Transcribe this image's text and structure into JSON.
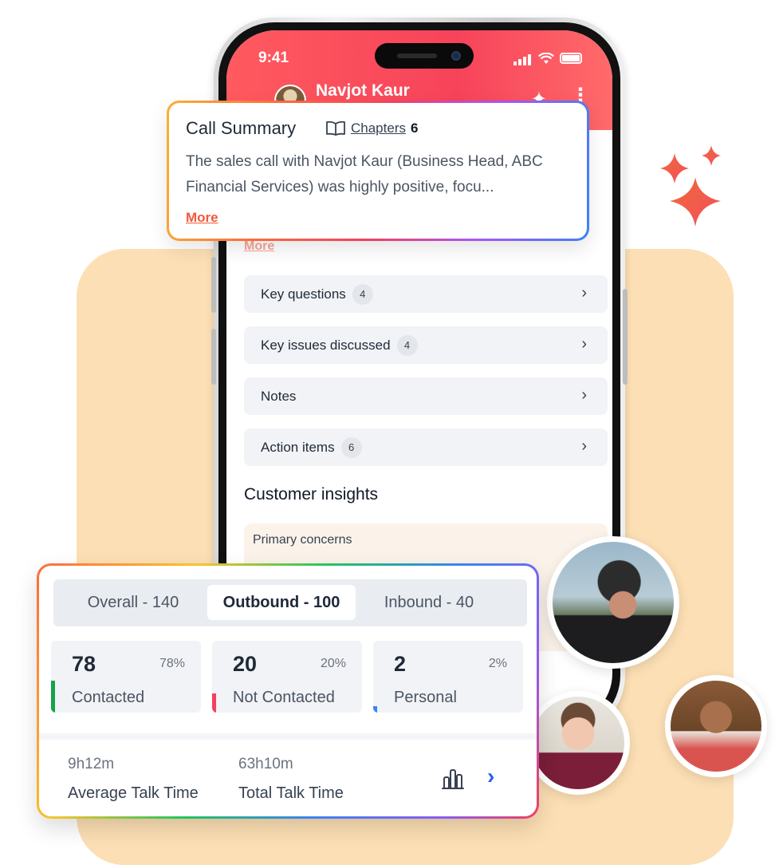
{
  "phone": {
    "status": {
      "time": "9:41"
    },
    "header": {
      "contact_name": "Navjot Kaur"
    },
    "faded_more": "More",
    "list_items": [
      {
        "label": "Key questions",
        "count": "4"
      },
      {
        "label": "Key issues discussed",
        "count": "4"
      },
      {
        "label": "Notes",
        "count": ""
      },
      {
        "label": "Action items",
        "count": "6"
      }
    ],
    "insights_title": "Customer insights",
    "concerns_label": "Primary concerns"
  },
  "summary_card": {
    "title": "Call Summary",
    "chapters_label": "Chapters",
    "chapters_count": "6",
    "text": "The sales call with Navjot Kaur (Business Head, ABC Financial Services) was highly positive, focu...",
    "more_label": "More"
  },
  "stats_card": {
    "tabs": [
      {
        "label": "Overall - 140",
        "active": false
      },
      {
        "label": "Outbound - 100",
        "active": true
      },
      {
        "label": "Inbound - 40",
        "active": false
      }
    ],
    "stats": [
      {
        "value": "78",
        "percent": "78%",
        "label": "Contacted",
        "accent": "#16a34a"
      },
      {
        "value": "20",
        "percent": "20%",
        "label": "Not Contacted",
        "accent": "#f43f5e"
      },
      {
        "value": "2",
        "percent": "2%",
        "label": "Personal",
        "accent": "#3b82f6"
      }
    ],
    "average_talk_time": {
      "value": "9h12m",
      "label": "Average Talk Time"
    },
    "total_talk_time": {
      "value": "63h10m",
      "label": "Total Talk Time"
    }
  },
  "colors": {
    "header_red": "#f7435a",
    "accent_orange": "#f05a3c",
    "link_blue": "#2563eb",
    "peach_background": "#fcdfb4"
  }
}
